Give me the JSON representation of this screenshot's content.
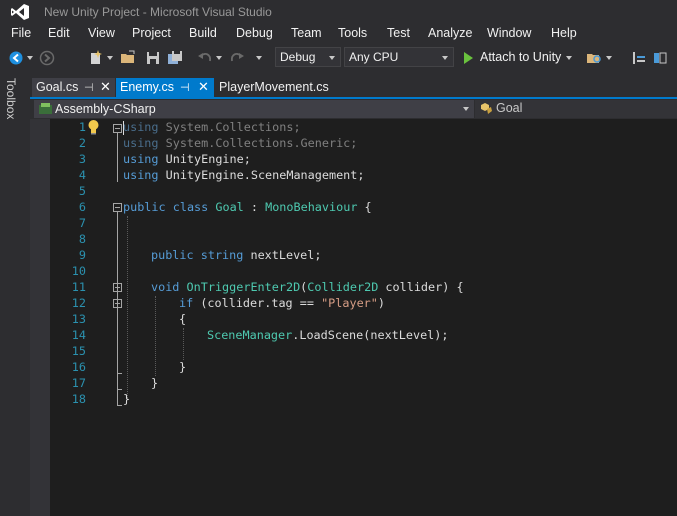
{
  "window": {
    "title": "New Unity Project - Microsoft Visual Studio"
  },
  "menu": [
    "File",
    "Edit",
    "View",
    "Project",
    "Build",
    "Debug",
    "Team",
    "Tools",
    "Test",
    "Analyze",
    "Window",
    "Help"
  ],
  "toolbar": {
    "configuration": "Debug",
    "platform": "Any CPU",
    "attach_label": "Attach to Unity"
  },
  "toolbox": {
    "label": "Toolbox"
  },
  "tabs": [
    {
      "label": "Goal.cs",
      "active": false
    },
    {
      "label": "Enemy.cs",
      "active": true
    },
    {
      "label": "PlayerMovement.cs",
      "active": false
    }
  ],
  "navbar": {
    "project": "Assembly-CSharp",
    "type": "Goal"
  },
  "code": {
    "line_numbers": [
      "1",
      "2",
      "3",
      "4",
      "5",
      "6",
      "7",
      "8",
      "9",
      "10",
      "11",
      "12",
      "13",
      "14",
      "15",
      "16",
      "17",
      "18"
    ],
    "l1_kw": "using",
    "l1_rest": " System.Collections;",
    "l2_kw": "using",
    "l2_rest": " System.Collections.Generic;",
    "l3_kw": "using",
    "l3_rest": " UnityEngine;",
    "l4_kw": "using",
    "l4_rest": " UnityEngine.SceneManagement;",
    "l6_kw1": "public",
    "l6_kw2": "class",
    "l6_name": "Goal",
    "l6_colon": " : ",
    "l6_base": "MonoBehaviour",
    "l6_brace": " {",
    "l9_kw1": "public",
    "l9_kw2": "string",
    "l9_rest": " nextLevel;",
    "l11_kw": "void",
    "l11_name": "OnTriggerEnter2D",
    "l11_paren": "(",
    "l11_type": "Collider2D",
    "l11_rest": " collider) {",
    "l12_kw": "if",
    "l12_rest": " (collider.tag == ",
    "l12_str": "\"Player\"",
    "l12_close": ")",
    "l13": "{",
    "l14_type": "SceneManager",
    "l14_rest": ".LoadScene(nextLevel);",
    "l16": "}",
    "l17": "}",
    "l18": "}"
  },
  "colors": {
    "accent": "#007acc",
    "editor_bg": "#1e1e1e",
    "keyword": "#569cd6",
    "type": "#4ec9b0",
    "string": "#d69d85",
    "line_number": "#2b91af"
  }
}
